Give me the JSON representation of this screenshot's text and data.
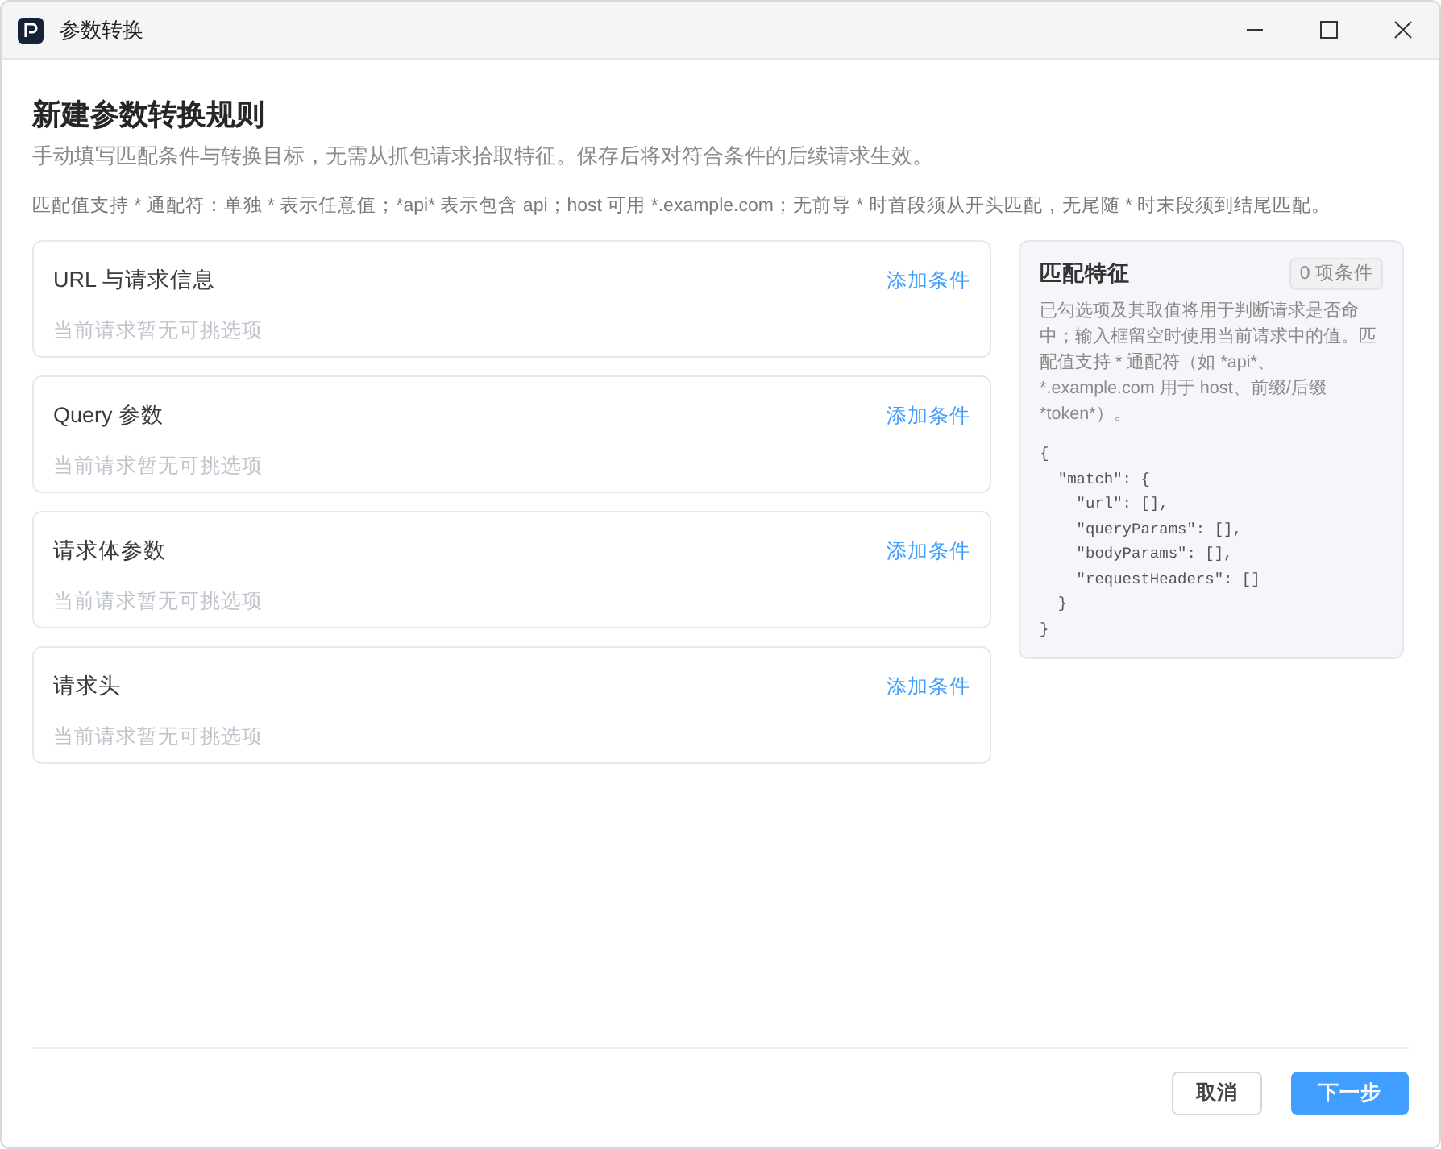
{
  "window": {
    "title": "参数转换"
  },
  "header": {
    "title": "新建参数转换规则",
    "subtitle": "手动填写匹配条件与转换目标，无需从抓包请求拾取特征。保存后将对符合条件的后续请求生效。",
    "hint": "匹配值支持 * 通配符：单独 * 表示任意值；*api* 表示包含 api；host 可用 *.example.com；无前导 * 时首段须从开头匹配，无尾随 * 时末段须到结尾匹配。"
  },
  "sections": [
    {
      "title": "URL 与请求信息",
      "action": "添加条件",
      "empty_text": "当前请求暂无可挑选项"
    },
    {
      "title": "Query 参数",
      "action": "添加条件",
      "empty_text": "当前请求暂无可挑选项"
    },
    {
      "title": "请求体参数",
      "action": "添加条件",
      "empty_text": "当前请求暂无可挑选项"
    },
    {
      "title": "请求头",
      "action": "添加条件",
      "empty_text": "当前请求暂无可挑选项"
    }
  ],
  "match_panel": {
    "title": "匹配特征",
    "badge": "0 项条件",
    "description": "已勾选项及其取值将用于判断请求是否命中；输入框留空时使用当前请求中的值。匹配值支持 * 通配符（如 *api*、*.example.com 用于 host、前缀/后缀 *token*）。",
    "code": "{\n  \"match\": {\n    \"url\": [],\n    \"queryParams\": [],\n    \"bodyParams\": [],\n    \"requestHeaders\": []\n  }\n}"
  },
  "footer": {
    "buttons": [
      {
        "label": "取消",
        "kind": "secondary"
      },
      {
        "label": "下一步",
        "kind": "primary"
      }
    ]
  }
}
